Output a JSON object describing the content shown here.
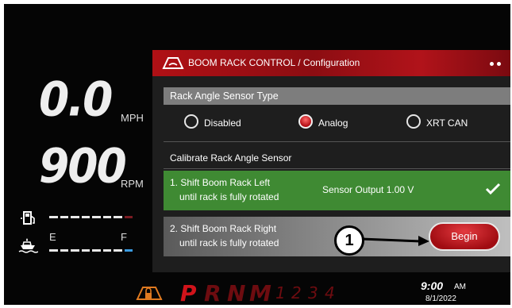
{
  "speed": {
    "value": "0.0",
    "unit": "MPH"
  },
  "rpm": {
    "value": "900",
    "unit": "RPM"
  },
  "fuel_gauge": {
    "icon": "fuel-pump-icon"
  },
  "tank_gauge": {
    "icon": "boat-tank-icon",
    "empty_label": "E",
    "full_label": "F"
  },
  "header": {
    "icon": "boom-rack-icon",
    "title": "BOOM RACK CONTROL / Configuration"
  },
  "sensor_type": {
    "title": "Rack Angle Sensor Type",
    "options": [
      {
        "label": "Disabled",
        "selected": false
      },
      {
        "label": "Analog",
        "selected": true
      },
      {
        "label": "XRT CAN",
        "selected": false
      }
    ]
  },
  "calibrate": {
    "title": "Calibrate Rack Angle Sensor"
  },
  "steps": [
    {
      "line1": "1. Shift Boom Rack Left",
      "line2": "until rack is fully rotated",
      "output": "Sensor Output 1.00 V",
      "done": true
    },
    {
      "line1": "2. Shift Boom Rack Right",
      "line2": "until rack is fully rotated",
      "button": "Begin"
    }
  ],
  "callout": "1",
  "gear_selector": {
    "active": "P",
    "gears": [
      "P",
      "R",
      "N",
      "M"
    ],
    "numbers": [
      "1",
      "2",
      "3",
      "4"
    ]
  },
  "clock": {
    "time": "9:00",
    "ampm": "AM",
    "date": "8/1/2022"
  },
  "colors": {
    "accent": "#b01015",
    "success": "#3f8a33",
    "section": "#7d7d7d"
  }
}
